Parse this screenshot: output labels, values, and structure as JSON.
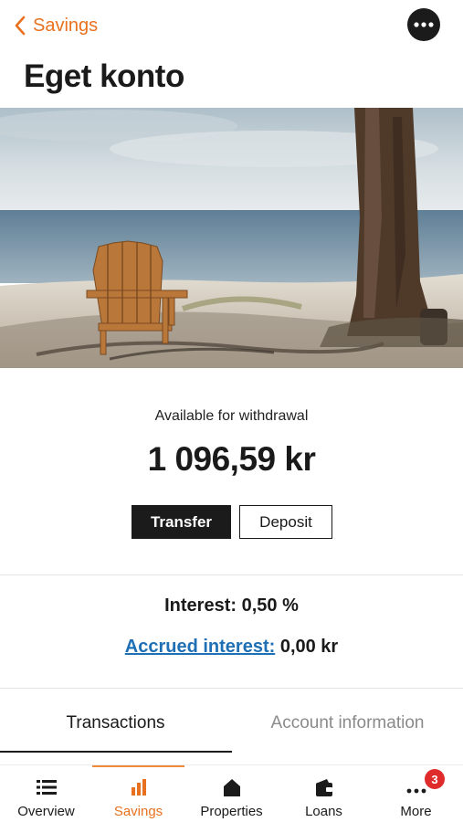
{
  "header": {
    "back_label": "Savings",
    "title": "Eget konto"
  },
  "hero_image": {
    "subject": "wooden chair on a beach beside a pine tree"
  },
  "balance": {
    "label": "Available for withdrawal",
    "amount": "1 096,59 kr"
  },
  "actions": {
    "transfer_label": "Transfer",
    "deposit_label": "Deposit"
  },
  "interest": {
    "interest_text": "Interest: 0,50 %",
    "accrued_link_label": "Accrued interest:",
    "accrued_value": "0,00 kr"
  },
  "tabs": [
    {
      "label": "Transactions",
      "active": true
    },
    {
      "label": "Account information",
      "active": false
    }
  ],
  "bottom_nav": [
    {
      "label": "Overview",
      "icon": "list-icon",
      "active": false
    },
    {
      "label": "Savings",
      "icon": "bar-chart-icon",
      "active": true
    },
    {
      "label": "Properties",
      "icon": "house-icon",
      "active": false
    },
    {
      "label": "Loans",
      "icon": "wallet-icon",
      "active": false
    },
    {
      "label": "More",
      "icon": "more-dots-icon",
      "active": false,
      "badge": "3"
    }
  ],
  "colors": {
    "accent": "#e8711f",
    "link": "#1f6fb5",
    "dark": "#1b1b1b",
    "badge": "#e02b2b"
  }
}
